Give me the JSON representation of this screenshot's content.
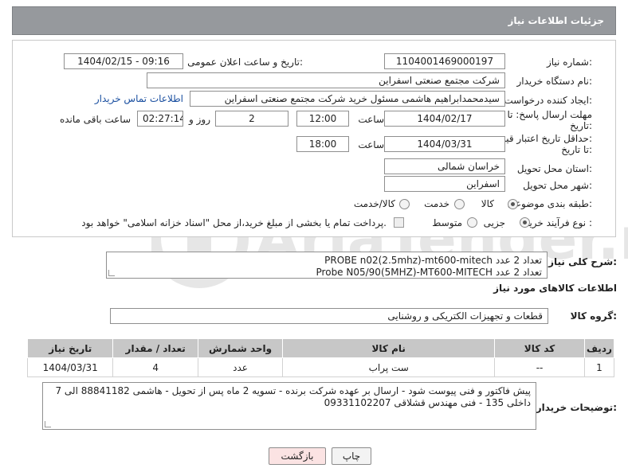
{
  "header": {
    "title": "جزئیات اطلاعات نیاز"
  },
  "form": {
    "need_number": {
      "label": "شماره نیاز:",
      "value": "1104001469000197"
    },
    "announce_datetime": {
      "label": "تاریخ و ساعت اعلان عمومی:",
      "value": "1404/02/15 - 09:16"
    },
    "buyer_org": {
      "label": "نام دستگاه خریدار:",
      "value": "شرکت مجتمع صنعتی اسفراین"
    },
    "requester": {
      "label": "ایجاد کننده درخواست:",
      "value": "سیدمحمدابراهیم هاشمی مسئول خرید شرکت مجتمع صنعتی اسفراین",
      "contact_link": "اطلاعات تماس خریدار"
    },
    "reply_deadline": {
      "label_line1": "مهلت ارسال پاسخ: تا",
      "label_line2": "تاریخ:",
      "date": "1404/02/17",
      "time_label": "ساعت",
      "time": "12:00",
      "days": "2",
      "days_label": "روز و",
      "remaining": "02:27:14",
      "remaining_label": "ساعت باقی مانده"
    },
    "price_validity": {
      "label_line1": "حداقل تاریخ اعتبار قیمت:",
      "label_line2": "تا تاریخ:",
      "date": "1404/03/31",
      "time_label": "ساعت",
      "time": "18:00"
    },
    "delivery_province": {
      "label": "استان محل تحویل:",
      "value": "خراسان شمالی"
    },
    "delivery_city": {
      "label": "شهر محل تحویل:",
      "value": "اسفراین"
    },
    "category": {
      "label": "طبقه بندی موضوعی:",
      "options": [
        "کالا",
        "خدمت",
        "کالا/خدمت"
      ],
      "selected": "کالا"
    },
    "purchase_process": {
      "label": "نوع فرآیند خرید :",
      "options": [
        "جزیی",
        "متوسط"
      ],
      "selected": "جزیی",
      "payment_note": "پرداخت تمام یا بخشی از مبلغ خرید،از محل \"اسناد خزانه اسلامی\" خواهد بود."
    }
  },
  "summary": {
    "label": "شرح کلی نیاز:",
    "line1": "PROBE n02(2.5mhz)-mt600-mitech تعداد 2 عدد",
    "line2": "Probe N05/90(5MHZ)-MT600-MITECH تعداد 2 عدد"
  },
  "goods_info": {
    "title": "اطلاعات کالاهای مورد نیاز"
  },
  "goods_group": {
    "label": "گروه کالا:",
    "value": "قطعات و تجهیزات الکتریکی و روشنایی"
  },
  "table": {
    "headers": [
      "ردیف",
      "کد کالا",
      "نام کالا",
      "واحد شمارش",
      "تعداد / مقدار",
      "تاریخ نیاز"
    ],
    "rows": [
      [
        "1",
        "--",
        "ست پراب",
        "عدد",
        "4",
        "1404/03/31"
      ]
    ]
  },
  "buyer_notes": {
    "label": "توضیحات خریدار:",
    "text": "پیش فاکتور و فنی پیوست شود - ارسال بر عهده شرکت برنده - تسویه 2 ماه پس از تحویل - هاشمی 88841182 الی 7 داخلی 135 - فنی مهندس قشلاقی 09331102207"
  },
  "buttons": {
    "print": "چاپ",
    "back": "بازگشت"
  },
  "watermark": {
    "text": "AriaTender.neT"
  },
  "colors": {
    "header_bg": "#96999d",
    "table_header_bg": "#c7c7c7",
    "back_button_bg": "#fbe3e3",
    "link": "#1a4fa0"
  }
}
